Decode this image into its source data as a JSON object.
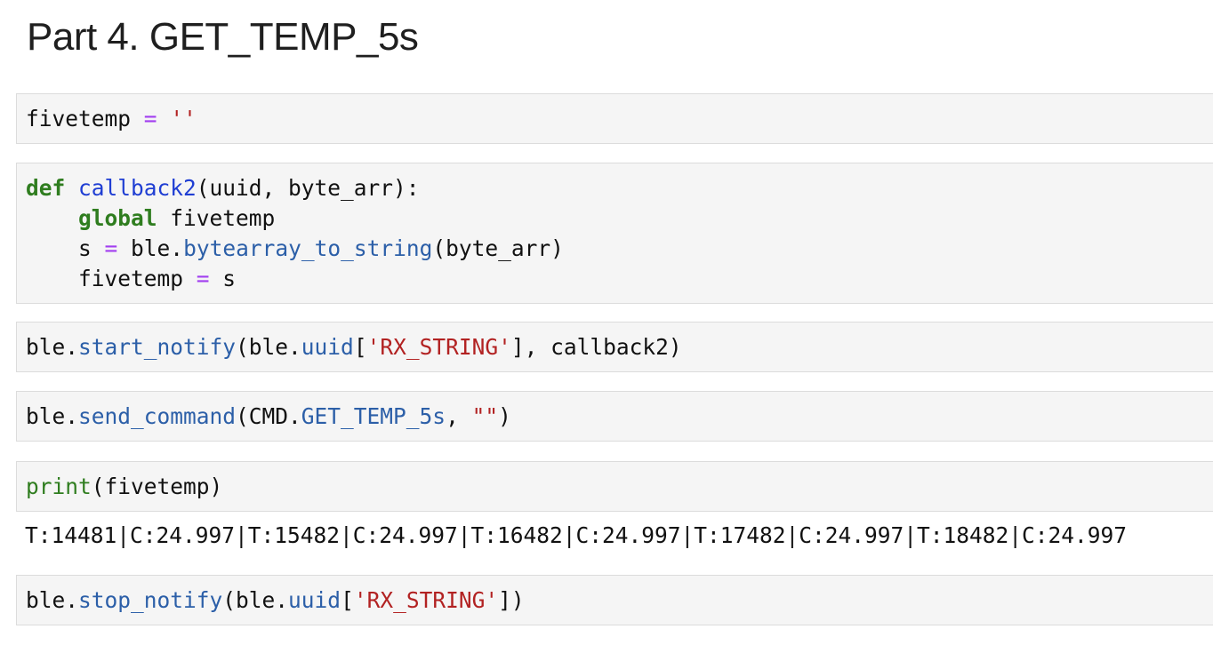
{
  "heading": "Part 4. GET_TEMP_5s",
  "cells": {
    "c1": {
      "var": "fivetemp",
      "op": "=",
      "str": "''"
    },
    "c2": {
      "line1": {
        "def": "def",
        "fname": "callback2",
        "args": "(uuid, byte_arr):"
      },
      "line2": {
        "indent": "    ",
        "global": "global",
        "rest": " fivetemp"
      },
      "line3": {
        "indent": "    ",
        "s": "s ",
        "op": "=",
        "mid": " ble.",
        "method": "bytearray_to_string",
        "args": "(byte_arr)"
      },
      "line4": {
        "indent": "    ",
        "var": "fivetemp ",
        "op": "=",
        "rest": " s"
      }
    },
    "c3": {
      "obj": "ble.",
      "method": "start_notify",
      "p1": "(ble.",
      "attr": "uuid",
      "p2": "[",
      "str": "'RX_STRING'",
      "p3": "], callback2)"
    },
    "c4": {
      "obj": "ble.",
      "method": "send_command",
      "p1": "(CMD.",
      "attr": "GET_TEMP_5s",
      "p2": ", ",
      "str": "\"\"",
      "p3": ")"
    },
    "c5": {
      "fn": "print",
      "args": "(fivetemp)"
    },
    "c5_output": "T:14481|C:24.997|T:15482|C:24.997|T:16482|C:24.997|T:17482|C:24.997|T:18482|C:24.997",
    "c6": {
      "obj": "ble.",
      "method": "stop_notify",
      "p1": "(ble.",
      "attr": "uuid",
      "p2": "[",
      "str": "'RX_STRING'",
      "p3": "])"
    }
  },
  "colors": {
    "keyword": "#2f7d1f",
    "function_name": "#1f3ed3",
    "operator": "#a23ef0",
    "string": "#b22222",
    "attribute": "#2c5fa8",
    "cell_background": "#f5f5f5"
  }
}
